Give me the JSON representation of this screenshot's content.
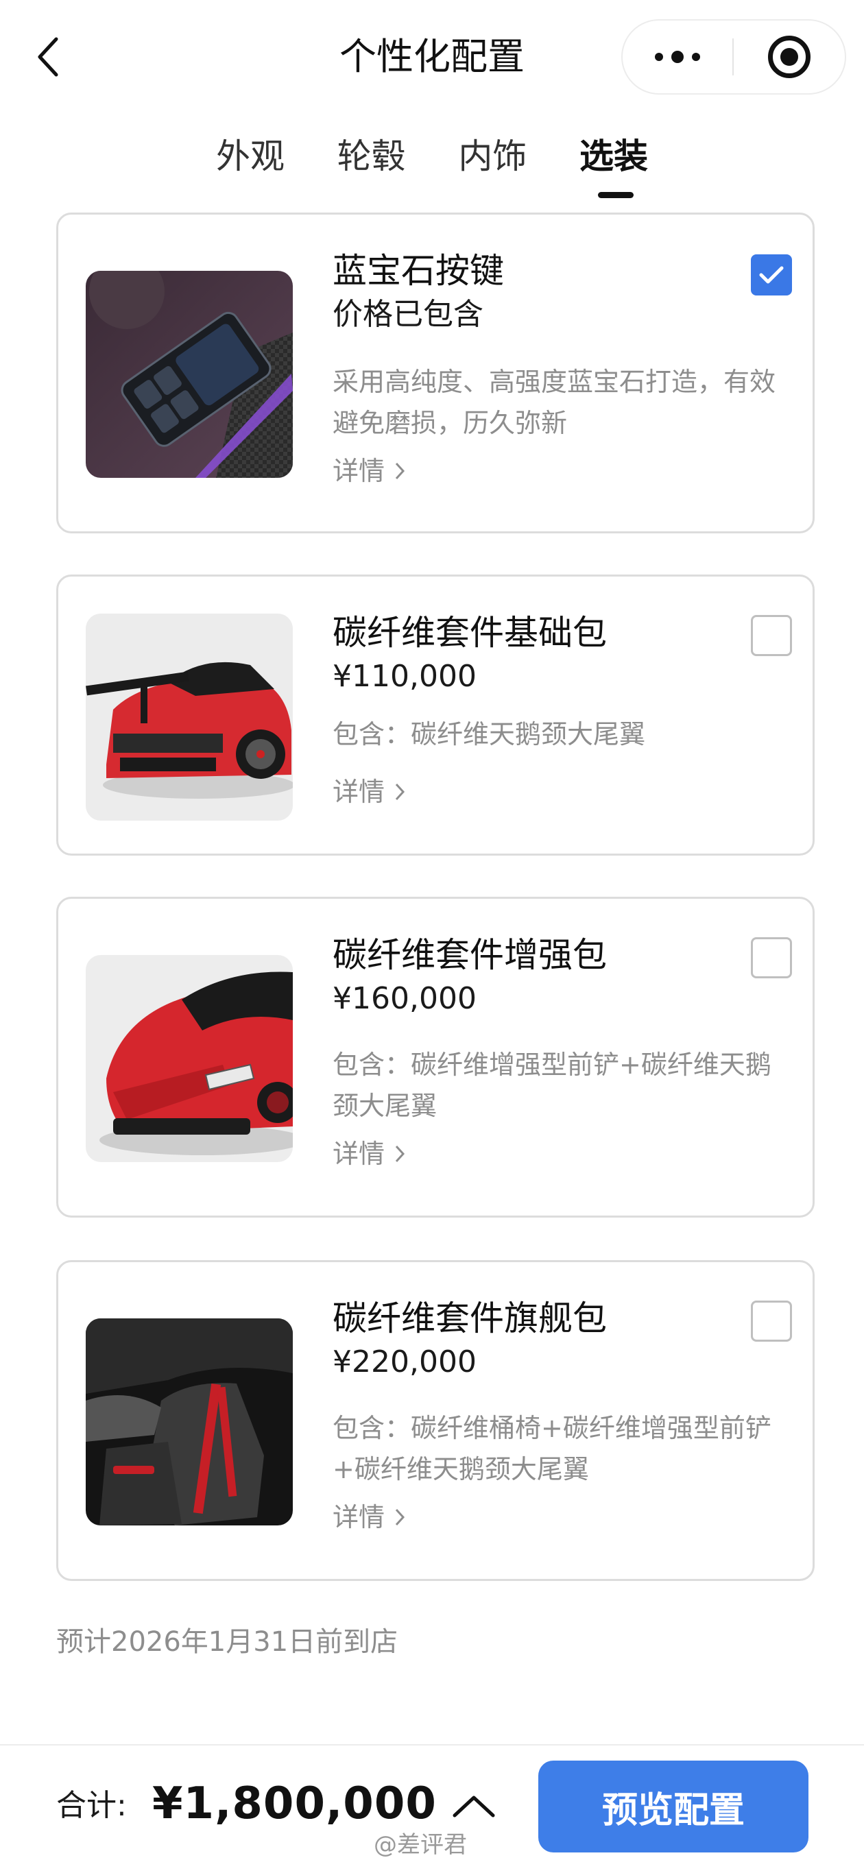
{
  "header": {
    "title": "个性化配置"
  },
  "tabs": [
    {
      "label": "外观",
      "active": false
    },
    {
      "label": "轮毂",
      "active": false
    },
    {
      "label": "内饰",
      "active": false
    },
    {
      "label": "选装",
      "active": true
    }
  ],
  "options": [
    {
      "name": "蓝宝石按键",
      "price": "价格已包含",
      "description": "采用高纯度、高强度蓝宝石打造，有效避免磨损，历久弥新",
      "detail_label": "详情",
      "checked": true,
      "image_icon": "sapphire-key-panel-photo"
    },
    {
      "name": "碳纤维套件基础包",
      "price": "¥110,000",
      "description": "包含：碳纤维天鹅颈大尾翼",
      "detail_label": "详情",
      "checked": false,
      "image_icon": "red-car-rear-photo"
    },
    {
      "name": "碳纤维套件增强包",
      "price": "¥160,000",
      "description": "包含：碳纤维增强型前铲+碳纤维天鹅颈大尾翼",
      "detail_label": "详情",
      "checked": false,
      "image_icon": "red-car-front-photo"
    },
    {
      "name": "碳纤维套件旗舰包",
      "price": "¥220,000",
      "description": "包含：碳纤维桶椅+碳纤维增强型前铲+碳纤维天鹅颈大尾翼",
      "detail_label": "详情",
      "checked": false,
      "image_icon": "carbon-bucket-seat-photo"
    }
  ],
  "arrival_note": "预计2026年1月31日前到店",
  "footer": {
    "total_label": "合计:",
    "total_value": "¥1,800,000",
    "preview_button": "预览配置",
    "watermark": "@差评君"
  },
  "colors": {
    "accent": "#3e7ee8",
    "text_primary": "#111111",
    "text_secondary": "#8d8d8d",
    "card_border": "#dcdcdc"
  }
}
